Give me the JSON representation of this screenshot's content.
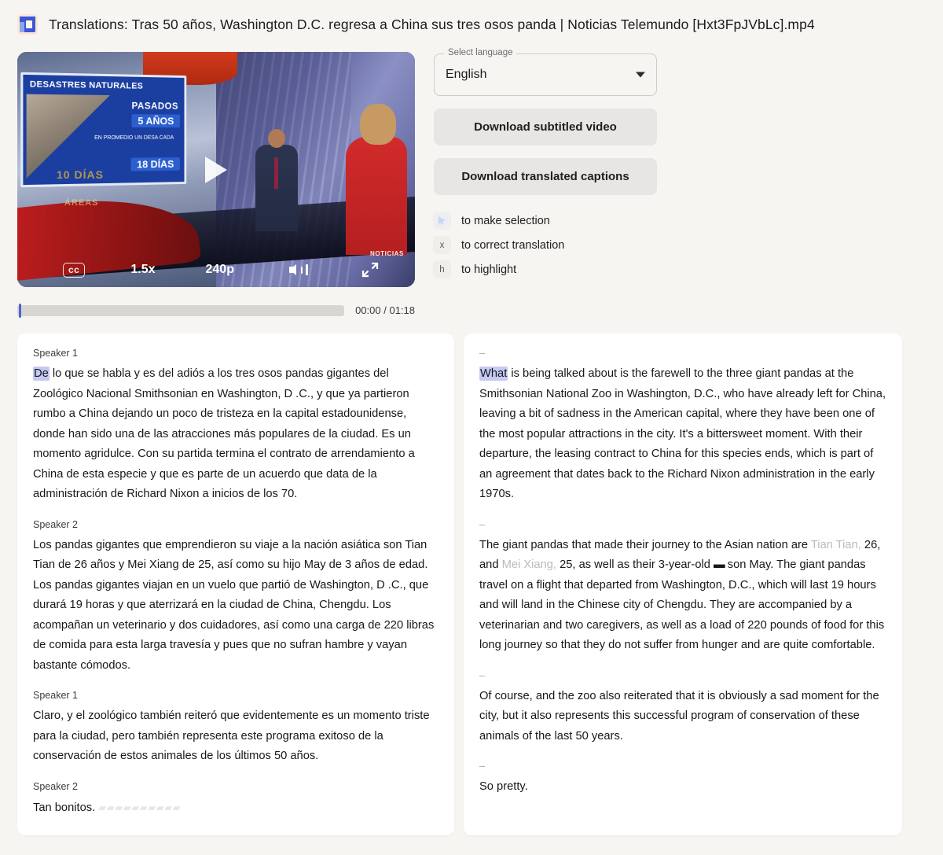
{
  "header": {
    "app_icon": "app-logo-icon",
    "title": "Translations: Tras 50 años, Washington D.C. regresa a China sus tres osos panda  |  Noticias Telemundo [Hxt3FpJVbLc].mp4"
  },
  "video": {
    "board_title": "DESASTRES NATURALES",
    "board_line1": "PASADOS",
    "board_line2": "5 AÑOS",
    "board_line3": "EN PROMEDIO UN DESA CADA",
    "board_line4": "18 DÍAS",
    "overlay_text_a": "10 DÍAS",
    "overlay_text_b": "ÁREAS",
    "channel_bug": "NOTICIAS",
    "controls": {
      "cc": "cc",
      "speed": "1.5x",
      "resolution": "240p",
      "volume_icon": "volume-icon",
      "fullscreen_icon": "fullscreen-icon",
      "play_icon": "play-icon"
    }
  },
  "progress": {
    "time": "00:00 / 01:18",
    "position_percent": 0
  },
  "controls_panel": {
    "select_label": "Select language",
    "select_value": "English",
    "caret_icon": "chevron-down-icon",
    "download_video_label": "Download subtitled video",
    "download_captions_label": "Download translated captions",
    "hints": [
      {
        "key": "",
        "key_icon": "cursor-select-icon",
        "text": "to make selection"
      },
      {
        "key": "x",
        "key_icon": "",
        "text": "to correct translation"
      },
      {
        "key": "h",
        "key_icon": "",
        "text": "to highlight"
      }
    ]
  },
  "transcript_source": {
    "blocks": [
      {
        "speaker": "Speaker 1",
        "highlight": "De",
        "text": " lo que se habla y es del adiós a los tres osos pandas gigantes del Zoológico Nacional Smithsonian en Washington, D .C., y que ya partieron rumbo a China dejando un poco de tristeza en la capital estadounidense, donde han sido una de las atracciones más populares de la ciudad. Es un momento agridulce. Con su partida termina el contrato de arrendamiento a China de esta especie y que es parte de un acuerdo que data de la administración de Richard Nixon a inicios de los 70."
      },
      {
        "speaker": "Speaker 2",
        "highlight": "",
        "text": "Los pandas gigantes que emprendieron su viaje a la nación asiática son Tian Tian de 26 años y Mei Xiang de 25, así como su hijo May de 3 años de edad. Los pandas gigantes viajan en un vuelo que partió de Washington, D .C., que durará 19 horas y que aterrizará en la ciudad de China, Chengdu. Los acompañan un veterinario y dos cuidadores, así como una carga de 220 libras de comida para esta larga travesía y pues que no sufran hambre y vayan bastante cómodos."
      },
      {
        "speaker": "Speaker 1",
        "highlight": "",
        "text": "Claro, y el zoológico también reiteró que evidentemente es un momento triste para la ciudad, pero también representa este programa exitoso de la conservación de estos animales de los últimos 50 años."
      },
      {
        "speaker": "Speaker 2",
        "highlight": "",
        "text": "Tan bonitos.",
        "ghost": "▰▰▰▰▰▰▰▰▰▰"
      }
    ]
  },
  "transcript_translated": {
    "blocks": [
      {
        "speaker": "–",
        "highlight": "What",
        "text_1": " is being talked about is the farewell to the three giant pandas at the Smithsonian National Zoo in Washington, D.C., who have already left for China, leaving a bit of sadness in the American capital, where they have been one of the most popular attractions in the city. It's a bittersweet moment. With their departure, the leasing contract to China for this species ends, which is part of an agreement that dates back to the Richard Nixon administration in the early 1970s."
      },
      {
        "speaker": "–",
        "text_1": "The giant pandas that made their journey to the Asian nation are ",
        "dim_1": "Tian Tian,",
        "text_2": " 26, and ",
        "dim_2": "Mei Xiang,",
        "text_3": " 25, as well as their 3-year-old ",
        "mark": "▬",
        "text_4": " son May. The giant pandas travel on a flight that departed from Washington, D.C., which will last 19 hours and will land in the Chinese city of Chengdu. They are accompanied by a veterinarian and two caregivers, as well as a load of 220 pounds of food for this long journey so that they do not suffer from hunger and are quite comfortable."
      },
      {
        "speaker": "–",
        "text_1": "Of course, and the zoo also reiterated that it is obviously a sad moment for the city, but it also represents this successful program of conservation of these animals of the last 50 years."
      },
      {
        "speaker": "–",
        "text_1": "So pretty."
      }
    ]
  }
}
